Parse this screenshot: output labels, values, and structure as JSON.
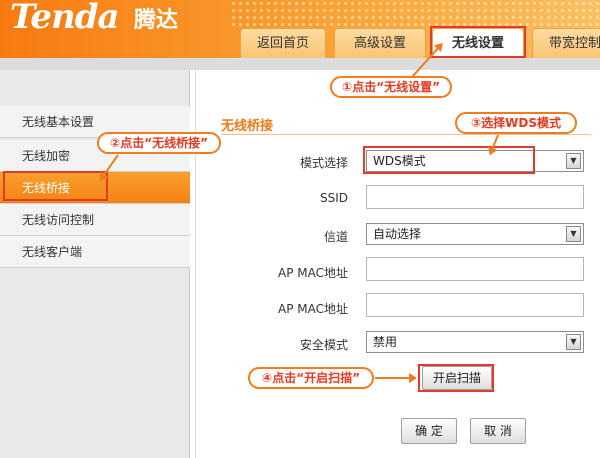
{
  "brand": {
    "logo": "Tenda",
    "logo_cn": "腾达"
  },
  "tabs": [
    {
      "label": "返回首页"
    },
    {
      "label": "高级设置"
    },
    {
      "label": "无线设置"
    },
    {
      "label": "带宽控制"
    }
  ],
  "sidebar": {
    "items": [
      {
        "label": "无线基本设置"
      },
      {
        "label": "无线加密"
      },
      {
        "label": "无线桥接"
      },
      {
        "label": "无线访问控制"
      },
      {
        "label": "无线客户端"
      }
    ]
  },
  "section": {
    "title": "无线桥接"
  },
  "form": {
    "mode_label": "模式选择",
    "mode_value": "WDS模式",
    "ssid_label": "SSID",
    "ssid_value": "",
    "channel_label": "信道",
    "channel_value": "自动选择",
    "ap_mac_label_1": "AP MAC地址",
    "ap_mac_value_1": "",
    "ap_mac_label_2": "AP MAC地址",
    "ap_mac_value_2": "",
    "security_label": "安全模式",
    "security_value": "禁用"
  },
  "buttons": {
    "scan": "开启扫描",
    "ok": "确 定",
    "cancel": "取 消"
  },
  "callouts": {
    "step1": "①点击“无线设置”",
    "step2": "②点击“无线桥接”",
    "step3": "③选择WDS模式",
    "step4": "④点击“开启扫描”"
  },
  "colors": {
    "brand_orange": "#f48312",
    "highlight_red": "#e23a2b",
    "callout_orange": "#ef7d1d"
  }
}
